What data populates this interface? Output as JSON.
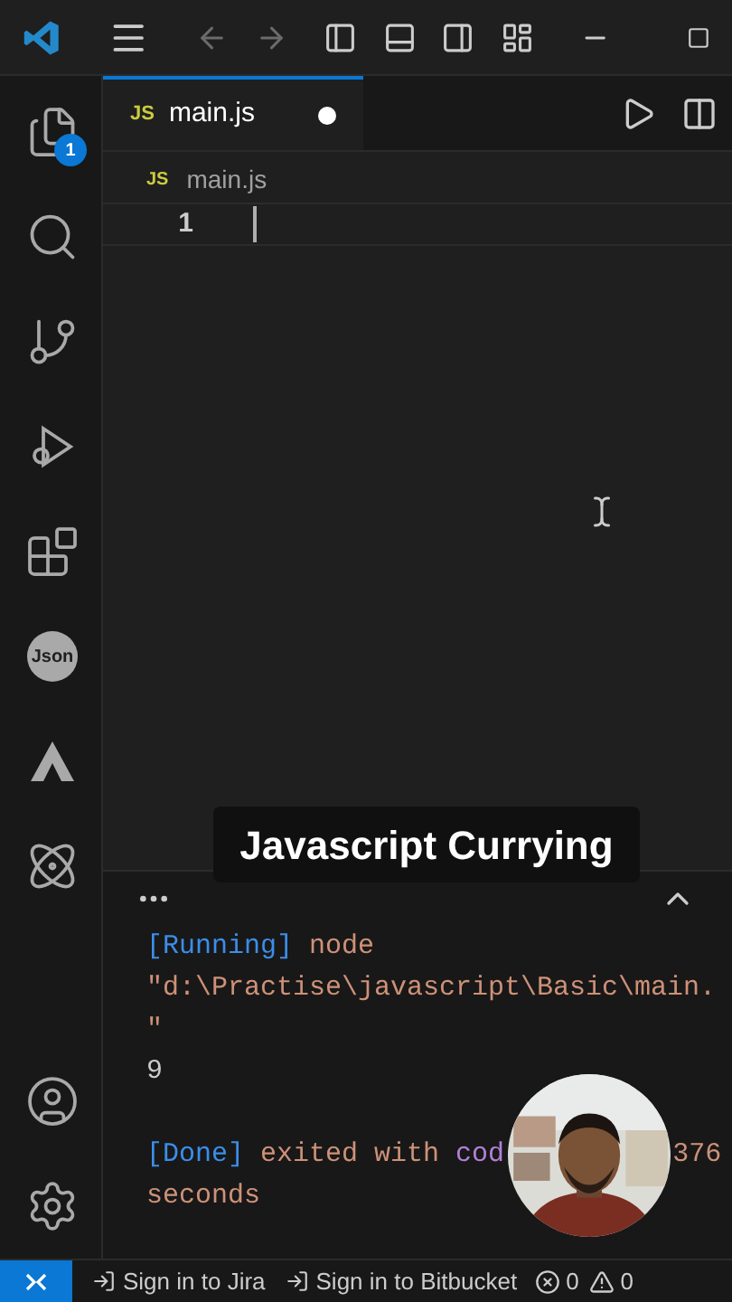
{
  "activity_bar": {
    "items": [
      {
        "kind": "files",
        "badge": "1",
        "selected": false
      },
      {
        "kind": "search",
        "selected": false
      },
      {
        "kind": "source-control",
        "selected": false
      },
      {
        "kind": "run",
        "selected": false
      },
      {
        "kind": "extensions",
        "selected": false
      },
      {
        "kind": "json",
        "label": "Json",
        "selected": false
      },
      {
        "kind": "triangle",
        "selected": false
      },
      {
        "kind": "atom",
        "selected": false
      }
    ],
    "bottom_items": [
      {
        "kind": "account"
      },
      {
        "kind": "settings"
      }
    ]
  },
  "tabs": [
    {
      "icon": "JS",
      "label": "main.js",
      "modified": true,
      "selected": true
    }
  ],
  "breadcrumb": {
    "icon": "JS",
    "label": "main.js"
  },
  "editor": {
    "line_numbers": [
      "1"
    ]
  },
  "caption": "Javascript Currying",
  "terminal": {
    "blocks": [
      [
        {
          "parts": [
            {
              "kind": "tag",
              "text": "[Running]"
            },
            {
              "kind": "plain",
              "text": "node"
            }
          ]
        },
        {
          "parts": [
            {
              "kind": "plain",
              "text": "\"d:\\Practise\\javascript\\Basic\\main."
            }
          ]
        },
        {
          "parts": [
            {
              "kind": "plain",
              "text": "\""
            }
          ]
        },
        {
          "parts": [
            {
              "kind": "output",
              "text": "9"
            }
          ]
        }
      ],
      [
        {
          "parts": [
            {
              "kind": "tag",
              "text": "[Done]"
            },
            {
              "kind": "plain",
              "text": "exited with"
            },
            {
              "kind": "code",
              "text": "cod"
            },
            {
              "kind": "gap",
              "text": "376"
            }
          ]
        },
        {
          "parts": [
            {
              "kind": "plain",
              "text": "seconds"
            }
          ]
        }
      ]
    ]
  },
  "status_bar": {
    "items": [
      {
        "kind": "sign-in",
        "label": "Sign in to Jira"
      },
      {
        "kind": "sign-in",
        "label": "Sign in to Bitbucket"
      }
    ],
    "errors": "0",
    "warnings": "0"
  }
}
